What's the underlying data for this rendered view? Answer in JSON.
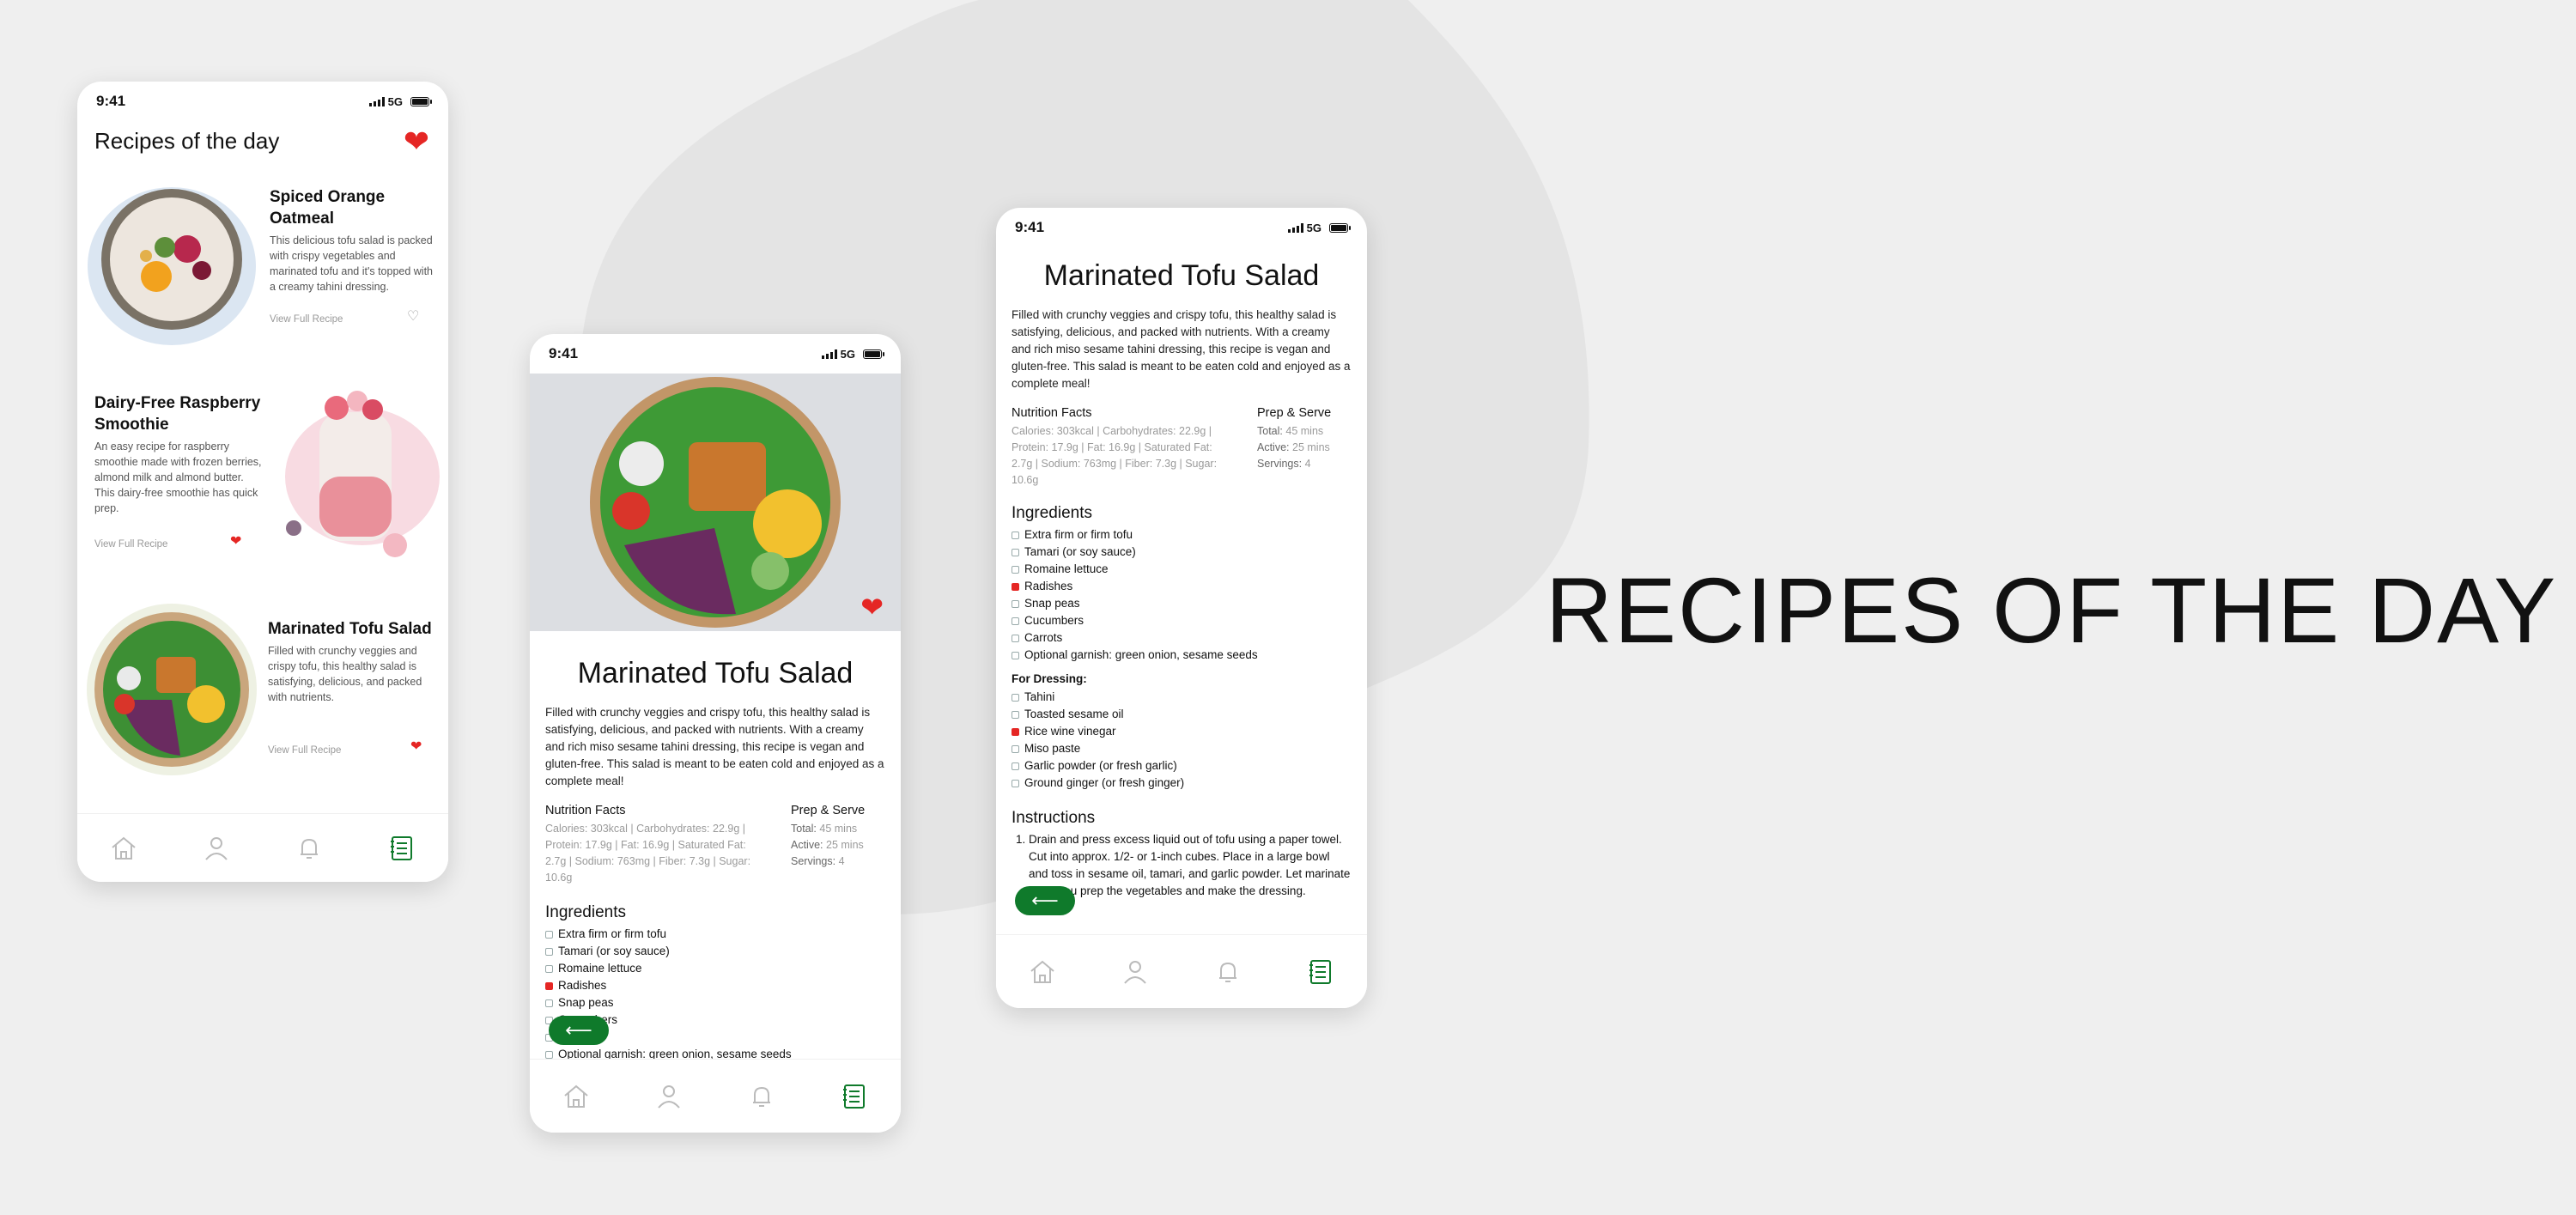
{
  "colors": {
    "accent_green": "#0f7a2b",
    "heart_red": "#e52624",
    "background": "#efefef"
  },
  "headline": "RECIPES OF THE DAY",
  "status": {
    "time": "9:41",
    "network": "5G"
  },
  "tabs": [
    "home-icon",
    "profile-icon",
    "bell-icon",
    "recipe-book-icon"
  ],
  "list_screen": {
    "title": "Recipes of the day",
    "recipes": [
      {
        "name": "Spiced Orange Oatmeal",
        "description": "This delicious tofu salad is packed with crispy vegetables and marinated tofu and it's topped with a creamy tahini dressing.",
        "link": "View Full Recipe",
        "favorite": false
      },
      {
        "name": "Dairy-Free Raspberry Smoothie",
        "description": "An easy recipe for raspberry smoothie made with frozen berries, almond milk and almond butter. This dairy-free smoothie has quick prep.",
        "link": "View Full Recipe",
        "favorite": true
      },
      {
        "name": "Marinated Tofu Salad",
        "description": "Filled with crunchy veggies and crispy tofu, this healthy salad is satisfying, delicious, and packed with nutrients.",
        "link": "View Full Recipe",
        "favorite": true
      }
    ]
  },
  "detail": {
    "title": "Marinated Tofu Salad",
    "description": "Filled with crunchy veggies and crispy tofu, this healthy salad is satisfying, delicious, and packed with nutrients. With a creamy and rich miso sesame tahini dressing, this recipe is vegan and gluten-free. This salad is meant to be eaten cold and enjoyed as a complete meal!",
    "nutrition_heading": "Nutrition Facts",
    "nutrition_text": "Calories: 303kcal | Carbohydrates: 22.9g | Protein: 17.9g | Fat: 16.9g | Saturated Fat: 2.7g | Sodium: 763mg | Fiber: 7.3g | Sugar: 10.6g",
    "prep_heading": "Prep & Serve",
    "prep": {
      "total_label": "Total:",
      "total": "45 mins",
      "active_label": "Active:",
      "active": "25 mins",
      "servings_label": "Servings:",
      "servings": "4"
    },
    "ingredients_heading": "Ingredients",
    "ingredients": [
      {
        "text": "Extra firm or firm tofu",
        "checked": false
      },
      {
        "text": "Tamari (or soy sauce)",
        "checked": false
      },
      {
        "text": "Romaine lettuce",
        "checked": false
      },
      {
        "text": "Radishes",
        "checked": true
      },
      {
        "text": "Snap peas",
        "checked": false
      },
      {
        "text": "Cucumbers",
        "checked": false
      },
      {
        "text": "Carrots",
        "checked": false
      },
      {
        "text": "Optional garnish: green onion, sesame seeds",
        "checked": false
      }
    ],
    "dressing_heading": "For Dressing:",
    "dressing": [
      {
        "text": "Tahini",
        "checked": false
      },
      {
        "text": "Toasted sesame oil",
        "checked": false
      },
      {
        "text": "Rice wine vinegar",
        "checked": true
      },
      {
        "text": "Miso paste",
        "checked": false
      },
      {
        "text": "Garlic powder (or fresh garlic)",
        "checked": false
      },
      {
        "text": "Ground ginger (or fresh ginger)",
        "checked": false
      }
    ],
    "instructions_heading": "Instructions",
    "instructions": [
      "Drain and press excess liquid out of tofu using a paper towel. Cut into approx. 1/2- or 1-inch cubes. Place in a large bowl and toss in sesame oil, tamari, and garlic powder. Let marinate while you prep the vegetables and make the dressing."
    ],
    "back_icon": "arrow-left-icon"
  }
}
